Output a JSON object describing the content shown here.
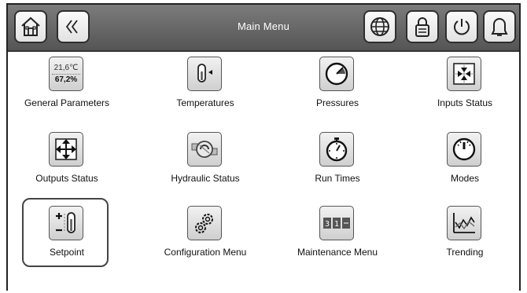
{
  "header": {
    "title": "Main Menu"
  },
  "toolbar": {
    "home_icon": "home-icon",
    "back_icon": "double-chevron-left-icon",
    "right_icons": [
      "globe-icon",
      "clipboard-lock-icon",
      "power-icon",
      "alarm-bell-icon"
    ]
  },
  "tiles": {
    "general": {
      "line1": "21,6℃",
      "line2": "67,2%"
    }
  },
  "menu": [
    {
      "label": "General Parameters"
    },
    {
      "label": "Temperatures"
    },
    {
      "label": "Pressures"
    },
    {
      "label": "Inputs Status"
    },
    {
      "label": "Outputs Status"
    },
    {
      "label": "Hydraulic Status"
    },
    {
      "label": "Run Times"
    },
    {
      "label": "Modes"
    },
    {
      "label": "Setpoint"
    },
    {
      "label": "Configuration Menu"
    },
    {
      "label": "Maintenance Menu"
    },
    {
      "label": "Trending"
    }
  ],
  "digits": {
    "d1": "3",
    "d2": "1"
  },
  "selected_item": "Setpoint",
  "colors": {
    "topbar": "#6a6a6a",
    "tile": "#dcdcdc",
    "border": "#333333"
  }
}
